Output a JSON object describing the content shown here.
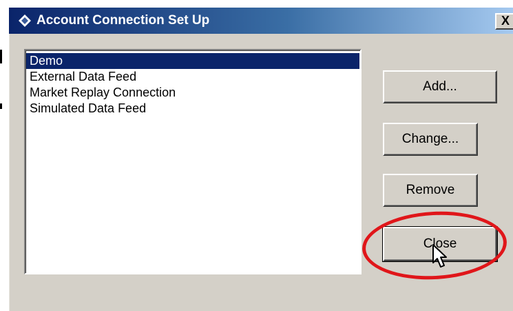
{
  "window": {
    "title": "Account Connection Set Up",
    "close_label": "X"
  },
  "connections": {
    "items": [
      {
        "label": "Demo",
        "selected": true
      },
      {
        "label": "External Data Feed",
        "selected": false
      },
      {
        "label": "Market Replay Connection",
        "selected": false
      },
      {
        "label": "Simulated Data Feed",
        "selected": false
      }
    ]
  },
  "buttons": {
    "add": "Add...",
    "change": "Change...",
    "remove": "Remove",
    "close": "Close"
  },
  "colors": {
    "title_bar_start": "#0a246a",
    "title_bar_end": "#a6caf0",
    "selection": "#0a246a",
    "face": "#d4d0c8",
    "annotation_ring": "#e0161a"
  },
  "icons": {
    "title": "diamond-app-icon",
    "cursor": "arrow-pointer-icon"
  }
}
